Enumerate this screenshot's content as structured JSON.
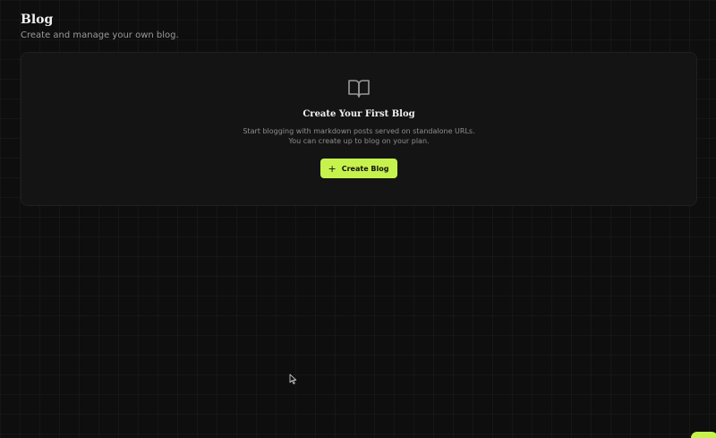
{
  "header": {
    "title": "Blog",
    "subtitle": "Create and manage your own blog."
  },
  "empty_state": {
    "icon": "book-open-icon",
    "title": "Create Your First Blog",
    "description": "Start blogging with markdown posts served on standalone URLs. You can create up to blog on your plan.",
    "button": {
      "icon": "plus-icon",
      "label": "Create Blog"
    }
  },
  "colors": {
    "background": "#0e0e0e",
    "card": "#141414",
    "accent": "#c6f24e",
    "text_primary": "#f2f2f2",
    "text_secondary": "#9a9a9a"
  },
  "widgets": {
    "chat_launcher_icon": "chat-launcher-icon",
    "cursor_icon": "mouse-cursor-icon"
  }
}
